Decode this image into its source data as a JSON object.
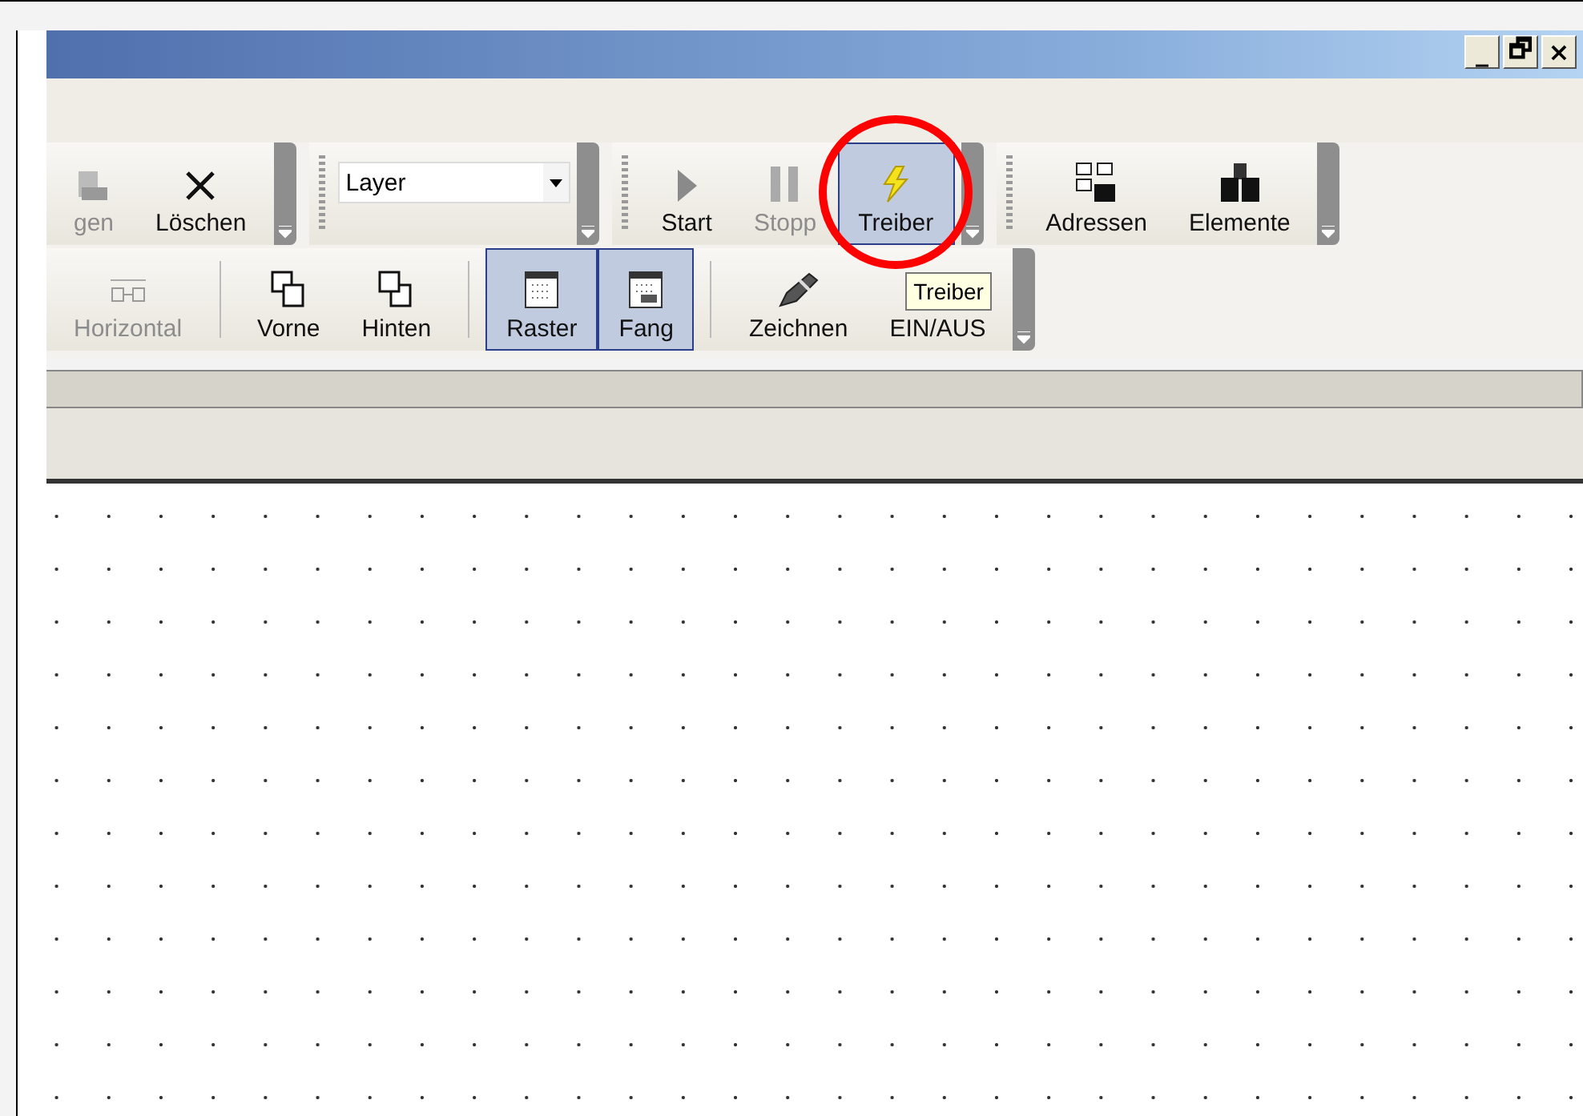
{
  "window": {
    "controls": [
      "_",
      "🗗",
      "×"
    ]
  },
  "toolbar_rows": [
    {
      "bands": [
        {
          "items": [
            {
              "kind": "button",
              "label": "gen",
              "disabled": true,
              "active": false
            },
            {
              "kind": "button",
              "label": "Löschen",
              "disabled": false,
              "active": false
            }
          ]
        },
        {
          "items": [
            {
              "kind": "combo",
              "value": "Layer"
            }
          ]
        },
        {
          "items": [
            {
              "kind": "button",
              "label": "Start",
              "disabled": false,
              "active": false
            },
            {
              "kind": "button",
              "label": "Stopp",
              "disabled": true,
              "active": false
            },
            {
              "kind": "button",
              "label": "Treiber",
              "disabled": false,
              "active": true
            }
          ]
        },
        {
          "items": [
            {
              "kind": "button",
              "label": "Adressen",
              "disabled": false,
              "active": false
            },
            {
              "kind": "button",
              "label": "Elemente",
              "disabled": false,
              "active": false
            }
          ]
        }
      ]
    },
    {
      "bands": [
        {
          "items": [
            {
              "kind": "button",
              "label": "Horizontal",
              "disabled": true,
              "active": false
            },
            {
              "kind": "separator"
            },
            {
              "kind": "button",
              "label": "Vorne",
              "disabled": false,
              "active": false
            },
            {
              "kind": "button",
              "label": "Hinten",
              "disabled": false,
              "active": false
            },
            {
              "kind": "separator"
            },
            {
              "kind": "button",
              "label": "Raster",
              "disabled": false,
              "active": true
            },
            {
              "kind": "button",
              "label": "Fang",
              "disabled": false,
              "active": true
            },
            {
              "kind": "separator"
            },
            {
              "kind": "button",
              "label": "Zeichnen",
              "disabled": false,
              "active": false
            },
            {
              "kind": "button",
              "label": "EIN/AUS",
              "disabled": false,
              "active": false
            }
          ]
        }
      ]
    }
  ],
  "tooltip": "Treiber"
}
